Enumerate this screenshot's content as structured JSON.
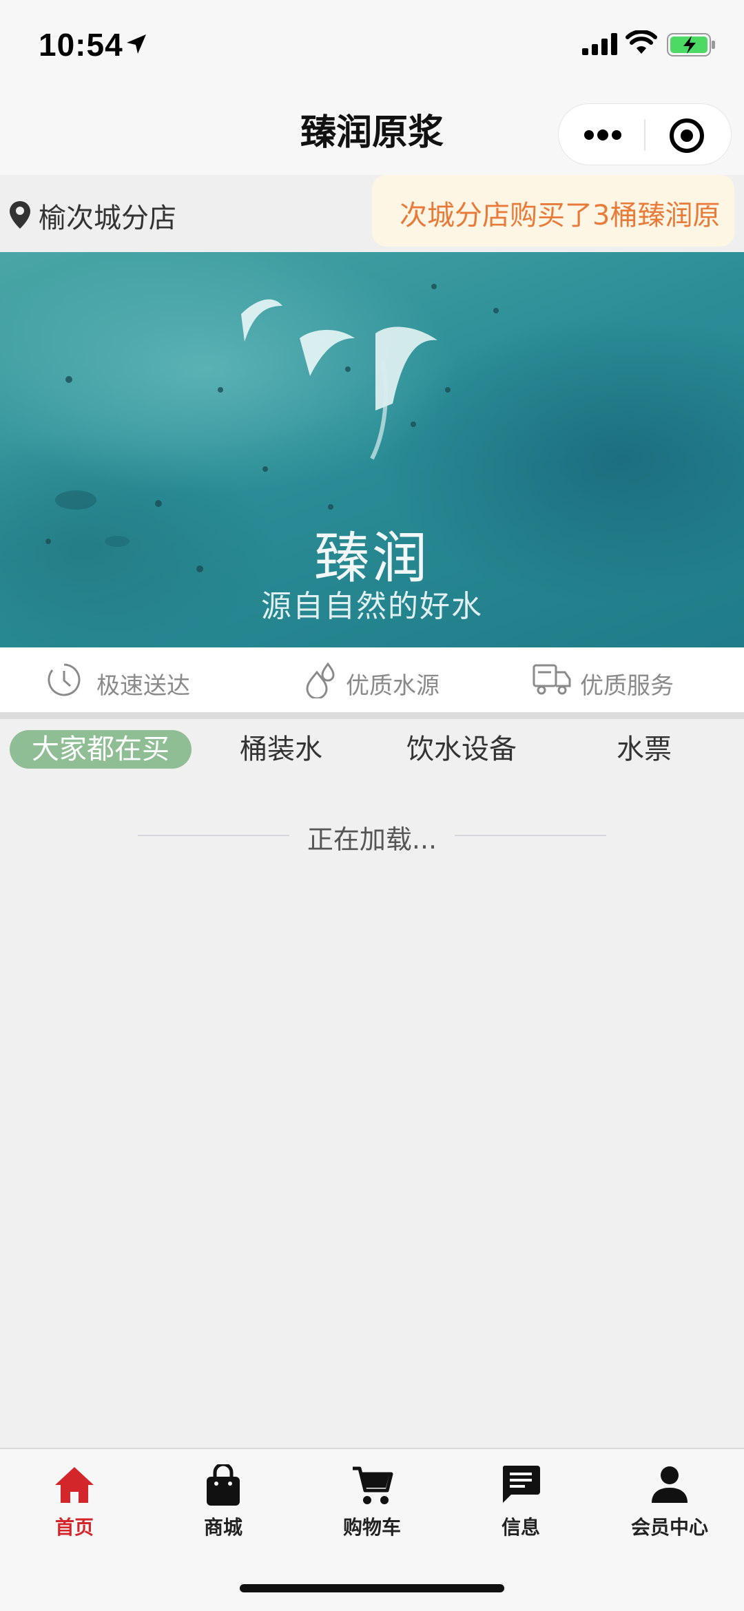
{
  "status_bar": {
    "time": "10:54"
  },
  "nav": {
    "title": "臻润原浆"
  },
  "store": {
    "name": "榆次城分店",
    "notice": "次城分店购买了3桶臻润原"
  },
  "banner": {
    "title": "臻润",
    "subtitle": "源自自然的好水"
  },
  "features": [
    {
      "label": "极速送达",
      "icon": "clock-icon"
    },
    {
      "label": "优质水源",
      "icon": "water-drop-icon"
    },
    {
      "label": "优质服务",
      "icon": "delivery-truck-icon"
    }
  ],
  "tabs": [
    {
      "label": "大家都在买",
      "active": true
    },
    {
      "label": "桶装水",
      "active": false
    },
    {
      "label": "饮水设备",
      "active": false
    },
    {
      "label": "水票",
      "active": false
    }
  ],
  "loading_text": "正在加载...",
  "tab_bar": [
    {
      "label": "首页",
      "icon": "home-icon",
      "active": true
    },
    {
      "label": "商城",
      "icon": "shopping-bag-icon",
      "active": false
    },
    {
      "label": "购物车",
      "icon": "cart-icon",
      "active": false
    },
    {
      "label": "信息",
      "icon": "message-icon",
      "active": false
    },
    {
      "label": "会员中心",
      "icon": "user-icon",
      "active": false
    }
  ],
  "colors": {
    "accent_active_tab": "#d2262b",
    "category_tab_active": "#8fbe94",
    "notice_text": "#e87a3a"
  }
}
